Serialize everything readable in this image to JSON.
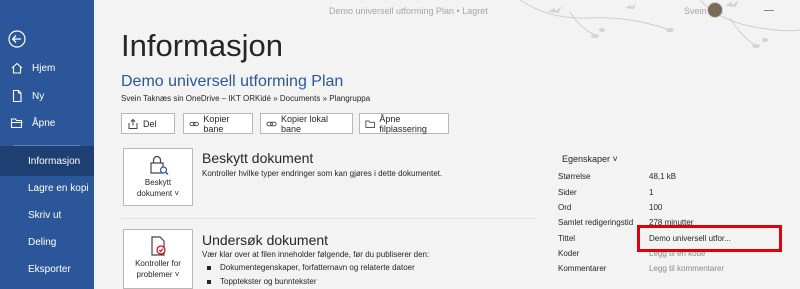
{
  "titlebar": {
    "doc_title": "Demo universell utforming Plan • Lagret",
    "user_name": "Svein Tak"
  },
  "sidebar": {
    "items": [
      {
        "label": "Hjem",
        "icon": "home-icon"
      },
      {
        "label": "Ny",
        "icon": "new-document-icon"
      },
      {
        "label": "Åpne",
        "icon": "open-folder-icon"
      },
      {
        "label": "Informasjon",
        "active": true
      },
      {
        "label": "Lagre en kopi"
      },
      {
        "label": "Skriv ut"
      },
      {
        "label": "Deling"
      },
      {
        "label": "Eksporter"
      }
    ]
  },
  "main": {
    "page_title": "Informasjon",
    "doc_name": "Demo universell utforming Plan",
    "breadcrumb": "Svein Taknæs sin OneDrive – IKT ORKidé » Documents » Plangruppa",
    "actions": [
      {
        "label": "Del",
        "icon": "share-icon"
      },
      {
        "label": "Kopier bane",
        "icon": "link-icon"
      },
      {
        "label": "Kopier lokal bane",
        "icon": "link-icon"
      },
      {
        "label": "Åpne filplassering",
        "icon": "folder-icon"
      }
    ],
    "protect": {
      "button_line1": "Beskytt",
      "button_line2": "dokument ˅",
      "title": "Beskytt dokument",
      "desc": "Kontroller hvilke typer endringer som kan gjøres i dette dokumentet."
    },
    "inspect": {
      "button_line1": "Kontroller for",
      "button_line2": "problemer ˅",
      "title": "Undersøk dokument",
      "desc": "Vær klar over at filen inneholder følgende, før du publiserer den:",
      "bullets": [
        "Dokumentegenskaper, forfatternavn og relaterte datoer",
        "Topptekster og bunntekster"
      ]
    }
  },
  "properties": {
    "header": "Egenskaper ˅",
    "rows": [
      {
        "label": "Størrelse",
        "value": "48,1 kB"
      },
      {
        "label": "Sider",
        "value": "1"
      },
      {
        "label": "Ord",
        "value": "100"
      },
      {
        "label": "Samlet redigeringstid",
        "value": "278 minutter"
      },
      {
        "label": "Tittel",
        "value": "Demo universell utfor..."
      },
      {
        "label": "Koder",
        "value": "Legg til en kode"
      },
      {
        "label": "Kommentarer",
        "value": "Legg til kommentarer"
      }
    ]
  },
  "colors": {
    "sidebar": "#2b579a",
    "sidebar_active": "#1e3f72",
    "accent": "#2b579a",
    "highlight": "#e0000e"
  }
}
